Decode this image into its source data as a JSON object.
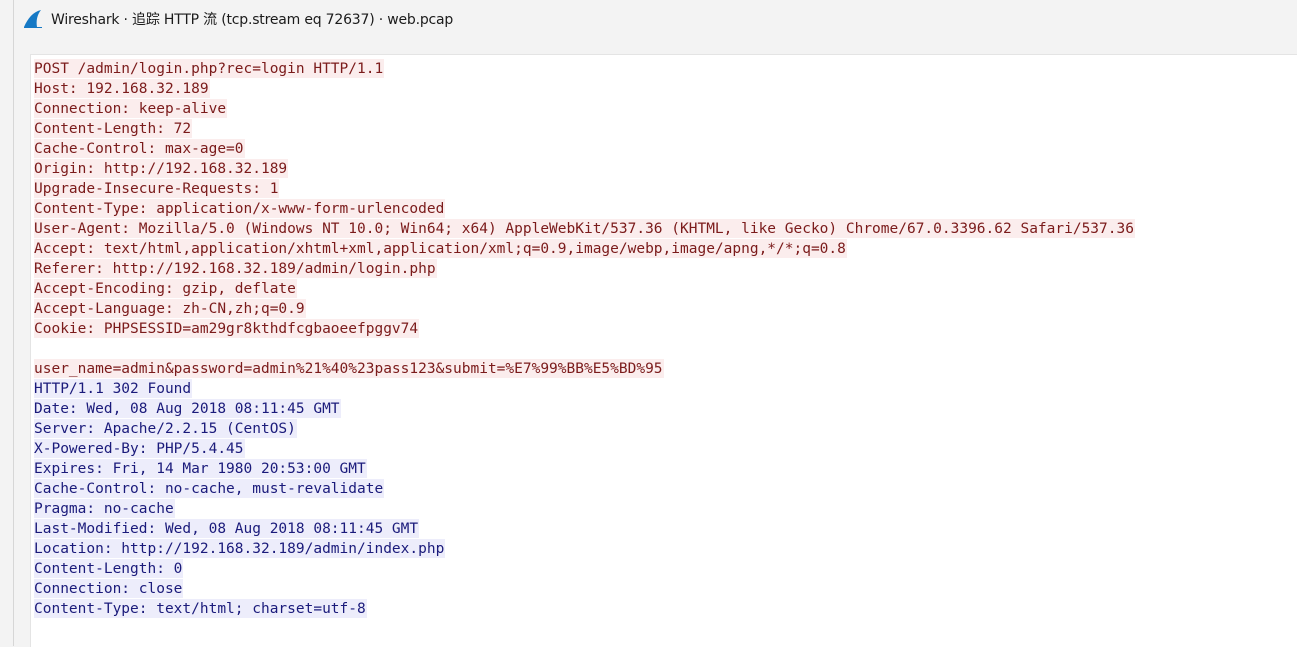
{
  "window": {
    "title": "Wireshark · 追踪 HTTP 流 (tcp.stream eq 72637) · web.pcap"
  },
  "colors": {
    "client_bg": "#fbeded",
    "client_fg": "#7b1b1b",
    "server_bg": "#ededfb",
    "server_fg": "#1b1b7b"
  },
  "stream": {
    "request_lines": [
      "POST /admin/login.php?rec=login HTTP/1.1",
      "Host: 192.168.32.189",
      "Connection: keep-alive",
      "Content-Length: 72",
      "Cache-Control: max-age=0",
      "Origin: http://192.168.32.189",
      "Upgrade-Insecure-Requests: 1",
      "Content-Type: application/x-www-form-urlencoded",
      "User-Agent: Mozilla/5.0 (Windows NT 10.0; Win64; x64) AppleWebKit/537.36 (KHTML, like Gecko) Chrome/67.0.3396.62 Safari/537.36",
      "Accept: text/html,application/xhtml+xml,application/xml;q=0.9,image/webp,image/apng,*/*;q=0.8",
      "Referer: http://192.168.32.189/admin/login.php",
      "Accept-Encoding: gzip, deflate",
      "Accept-Language: zh-CN,zh;q=0.9",
      "Cookie: PHPSESSID=am29gr8kthdfcgbaoeefpggv74"
    ],
    "request_body": "user_name=admin&password=admin%21%40%23pass123&submit=%E7%99%BB%E5%BD%95",
    "response_lines": [
      "HTTP/1.1 302 Found",
      "Date: Wed, 08 Aug 2018 08:11:45 GMT",
      "Server: Apache/2.2.15 (CentOS)",
      "X-Powered-By: PHP/5.4.45",
      "Expires: Fri, 14 Mar 1980 20:53:00 GMT",
      "Cache-Control: no-cache, must-revalidate",
      "Pragma: no-cache",
      "Last-Modified: Wed, 08 Aug 2018 08:11:45 GMT",
      "Location: http://192.168.32.189/admin/index.php",
      "Content-Length: 0",
      "Connection: close",
      "Content-Type: text/html; charset=utf-8"
    ]
  }
}
